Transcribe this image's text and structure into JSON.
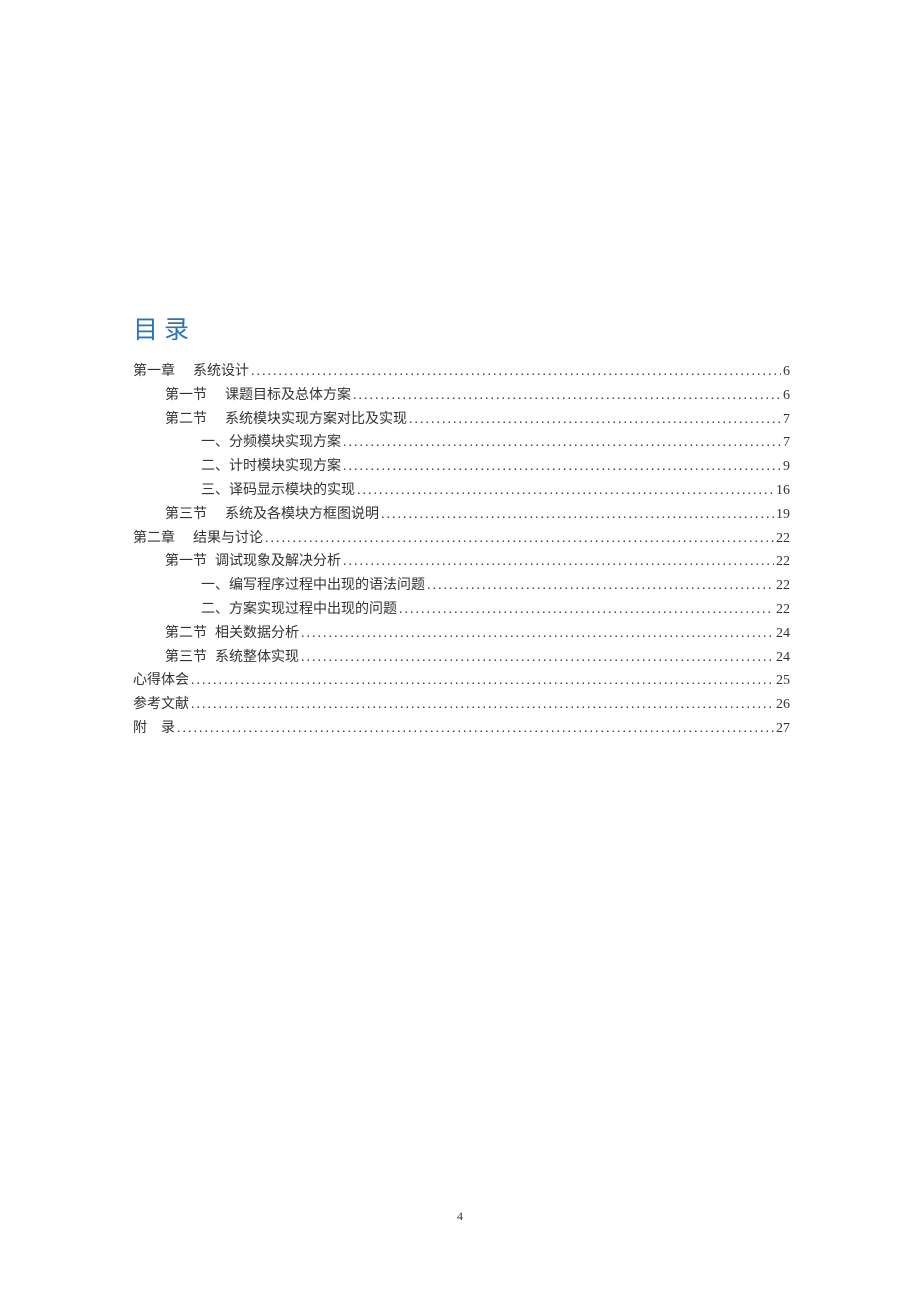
{
  "title": "目录",
  "entries": [
    {
      "indent": 0,
      "label": "第一章",
      "gap": "large",
      "text": "系统设计",
      "page": "6"
    },
    {
      "indent": 1,
      "label": "第一节",
      "gap": "large",
      "text": "课题目标及总体方案",
      "page": "6"
    },
    {
      "indent": 1,
      "label": "第二节",
      "gap": "large",
      "text": "系统模块实现方案对比及实现",
      "page": "7"
    },
    {
      "indent": 2,
      "label": "",
      "gap": "none",
      "text": "一、分频模块实现方案",
      "page": "7"
    },
    {
      "indent": 2,
      "label": "",
      "gap": "none",
      "text": "二、计时模块实现方案",
      "page": "9"
    },
    {
      "indent": 2,
      "label": "",
      "gap": "none",
      "text": "三、译码显示模块的实现",
      "page": "16"
    },
    {
      "indent": 1,
      "label": "第三节",
      "gap": "large",
      "text": "系统及各模块方框图说明",
      "page": "19"
    },
    {
      "indent": 0,
      "label": "第二章",
      "gap": "large",
      "text": "结果与讨论",
      "page": "22"
    },
    {
      "indent": 1,
      "label": "第一节",
      "gap": "small",
      "text": "调试现象及解决分析",
      "page": "22"
    },
    {
      "indent": 2,
      "label": "",
      "gap": "none",
      "text": "一、编写程序过程中出现的语法问题",
      "page": "22"
    },
    {
      "indent": 2,
      "label": "",
      "gap": "none",
      "text": "二、方案实现过程中出现的问题",
      "page": "22"
    },
    {
      "indent": 1,
      "label": "第二节",
      "gap": "small",
      "text": "相关数据分析",
      "page": "24"
    },
    {
      "indent": 1,
      "label": "第三节",
      "gap": "small",
      "text": "系统整体实现",
      "page": "24"
    },
    {
      "indent": 0,
      "label": "",
      "gap": "none",
      "text": "心得体会",
      "page": "25"
    },
    {
      "indent": 0,
      "label": "",
      "gap": "none",
      "text": "参考文献",
      "page": "26"
    },
    {
      "indent": 0,
      "label": "",
      "gap": "none",
      "text": "附　录",
      "page": "27"
    }
  ],
  "pageNumber": "4"
}
